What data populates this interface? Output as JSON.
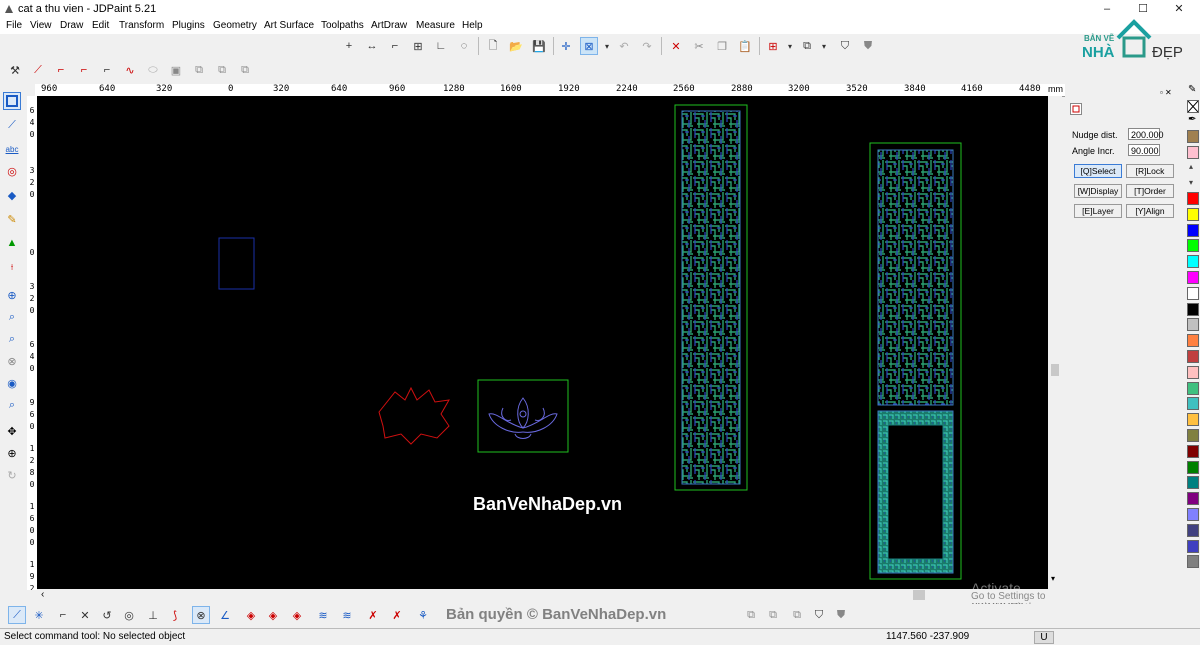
{
  "window": {
    "title": "cat a thu vien - JDPaint 5.21",
    "min": "–",
    "max": "☐",
    "close": "✕"
  },
  "menu": [
    "File",
    "View",
    "Draw",
    "Edit",
    "Transform",
    "Plugins",
    "Geometry",
    "Art Surface",
    "Toolpaths",
    "ArtDraw",
    "Measure",
    "Help"
  ],
  "ruler": {
    "ticks": [
      "960",
      "640",
      "320",
      "0",
      "320",
      "640",
      "960",
      "1280",
      "1600",
      "1920",
      "2240",
      "2560",
      "2880",
      "3200",
      "3520",
      "3840",
      "4160",
      "4480"
    ],
    "unit": "mm",
    "vertical": [
      "6",
      "4",
      "0",
      "3",
      "2",
      "0",
      "0",
      "3",
      "2",
      "0",
      "6",
      "4",
      "0",
      "9",
      "6",
      "0",
      "1",
      "2",
      "8",
      "0",
      "1",
      "6",
      "0",
      "0",
      "1",
      "9",
      "2"
    ]
  },
  "panel": {
    "nudge_label": "Nudge dist.",
    "nudge_value": "200.000",
    "angle_label": "Angle Incr.",
    "angle_value": "90.000",
    "buttons": {
      "select": "[Q]Select",
      "lock": "[R]Lock",
      "display": "[W]Display",
      "order": "[T]Order",
      "layer": "[E]Layer",
      "align": "[Y]Align"
    }
  },
  "palette": [
    "#ff0000",
    "#ffff00",
    "#0000ff",
    "#00ff00",
    "#00ffff",
    "#ff00ff",
    "#ffffff",
    "#000000",
    "#c0c0c0",
    "#ff8040",
    "#c04040",
    "#ffc0c0",
    "#40c080",
    "#40c0c0",
    "#ffc040",
    "#808040",
    "#800000",
    "#008000",
    "#008080",
    "#800080",
    "#8080ff",
    "#404080",
    "#4040c0",
    "#808080"
  ],
  "status": {
    "message": "Select command tool: No selected object",
    "coords": "1147.560 -237.909",
    "mode": "U"
  },
  "watermark": {
    "center": "BanVeNhaDep.vn",
    "bottom": "Bản quyền © BanVeNhaDep.vn"
  },
  "activation": {
    "title": "Activate Windows",
    "subtitle": "Go to Settings to activate Windows."
  },
  "logo": {
    "top": "BẢN VẼ",
    "left": "NHÀ",
    "right": "ĐẸP"
  }
}
